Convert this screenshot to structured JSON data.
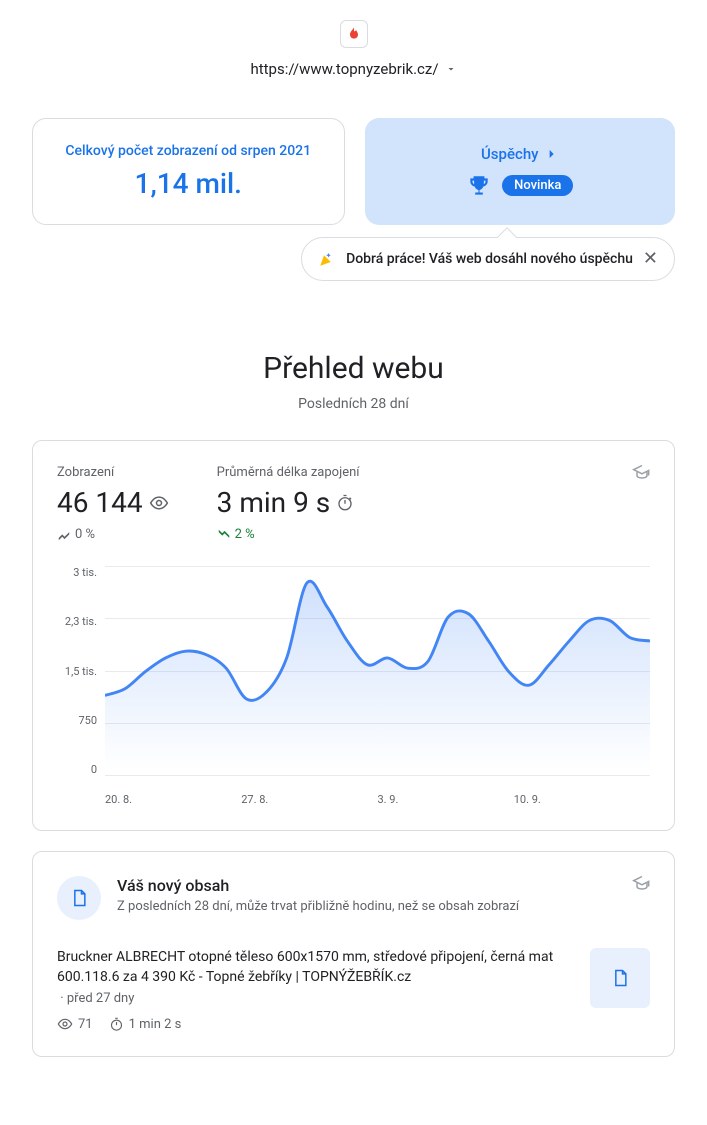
{
  "site_url": "https://www.topnyzebrik.cz/",
  "card_left": {
    "title": "Celkový počet zobrazení od srpen 2021",
    "value": "1,14 mil."
  },
  "card_right": {
    "title": "Úspěchy",
    "badge": "Novinka"
  },
  "tooltip": "Dobrá práce! Váš web dosáhl nového úspěchu",
  "section": {
    "title": "Přehled webu",
    "subtitle": "Posledních 28 dní"
  },
  "metrics": {
    "views_label": "Zobrazení",
    "views_value": "46 144",
    "views_trend": "0 %",
    "engagement_label": "Průměrná délka zapojení",
    "engagement_value": "3 min 9 s",
    "engagement_trend": "2 %"
  },
  "chart_data": {
    "type": "line",
    "x_labels": [
      "20. 8.",
      "27. 8.",
      "3. 9.",
      "10. 9."
    ],
    "y_labels": [
      "3 tis.",
      "2,3 tis.",
      "1,5 tis.",
      "750",
      "0"
    ],
    "ylim": [
      0,
      3000
    ],
    "series": [
      {
        "name": "Zobrazení",
        "values": [
          1100,
          1200,
          1450,
          1650,
          1750,
          1700,
          1500,
          1050,
          1150,
          1650,
          2750,
          2400,
          1900,
          1550,
          1650,
          1500,
          1600,
          2250,
          2300,
          1900,
          1450,
          1250,
          1550,
          1900,
          2200,
          2200,
          1950,
          1900
        ]
      }
    ]
  },
  "content": {
    "title": "Váš nový obsah",
    "subtitle": "Z posledních 28 dní, může trvat přibližně hodinu, než se obsah zobrazí",
    "item_title": "Bruckner ALBRECHT otopné těleso 600x1570 mm, středové připojení, černá mat 600.118.6 za 4 390 Kč - Topné žebříky | TOPNÝŽEBŘÍK.cz",
    "item_age": "před 27 dny",
    "item_views": "71",
    "item_duration": "1 min 2 s"
  }
}
